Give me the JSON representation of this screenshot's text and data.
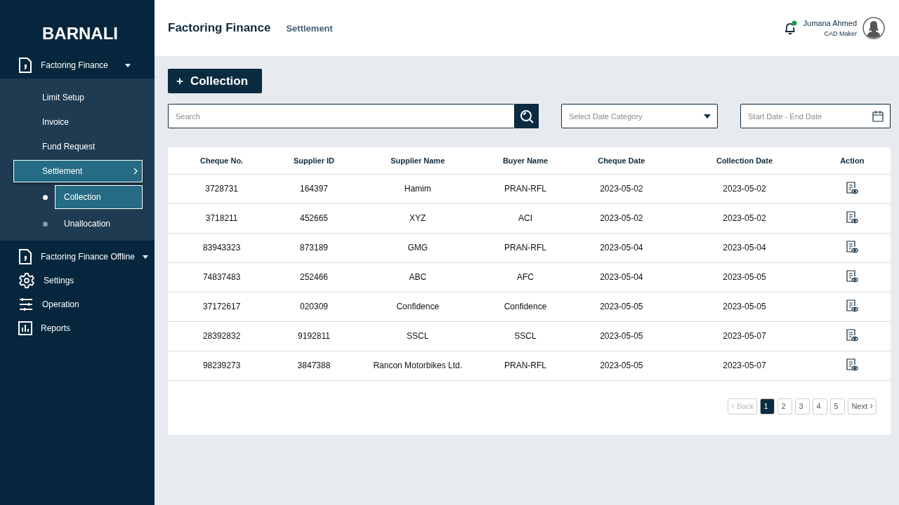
{
  "brand": "BARNALI",
  "sidebar": {
    "items": [
      {
        "kind": "menu",
        "label": "Factoring Finance",
        "children": [
          {
            "label": "Limit Setup",
            "selected": false
          },
          {
            "label": "Invoice",
            "selected": false
          },
          {
            "label": "Fund Request",
            "selected": false
          },
          {
            "label": "Settlement",
            "selected": true,
            "children": [
              {
                "label": "Collection",
                "selected": true
              },
              {
                "label": "Unallocation",
                "selected": false
              }
            ]
          }
        ]
      },
      {
        "kind": "menu",
        "label": "Factoring Finance Offline"
      },
      {
        "kind": "link",
        "label": "Settings"
      },
      {
        "kind": "link",
        "label": "Operation"
      },
      {
        "kind": "link",
        "label": "Reports"
      }
    ]
  },
  "header": {
    "title": "Factoring Finance",
    "breadcrumb": "Settlement",
    "notification_unread": true,
    "user": {
      "name": "Jumana Ahmed",
      "role": "CAD Maker"
    }
  },
  "add_button": {
    "icon": "+",
    "label": "Collection"
  },
  "filters": {
    "search": {
      "placeholder": "Search"
    },
    "date_category": {
      "placeholder": "Select Date Category"
    },
    "date_range": {
      "placeholder": "Start Date - End Date"
    }
  },
  "table": {
    "columns": [
      "Cheque No.",
      "Supplier ID",
      "Supplier Name",
      "Buyer Name",
      "Cheque Date",
      "Collection Date",
      "Action"
    ],
    "rows": [
      [
        "3728731",
        "164397",
        "Hamim",
        "PRAN-RFL",
        "2023-05-02",
        "2023-05-02"
      ],
      [
        "3718211",
        "452665",
        "XYZ",
        "ACI",
        "2023-05-02",
        "2023-05-02"
      ],
      [
        "83943323",
        "873189",
        "GMG",
        "PRAN-RFL",
        "2023-05-04",
        "2023-05-04"
      ],
      [
        "74837483",
        "252466",
        "ABC",
        "AFC",
        "2023-05-04",
        "2023-05-05"
      ],
      [
        "37172617",
        "020309",
        "Confidence",
        "Confidence",
        "2023-05-05",
        "2023-05-05"
      ],
      [
        "28392832",
        "9192811",
        "SSCL",
        "SSCL",
        "2023-05-05",
        "2023-05-07"
      ],
      [
        "98239273",
        "3847388",
        "Rancon Motorbikes Ltd.",
        "PRAN-RFL",
        "2023-05-05",
        "2023-05-07"
      ]
    ]
  },
  "pagination": {
    "back": {
      "label": "Back",
      "disabled": true
    },
    "pages": [
      {
        "label": "1",
        "selected": true
      },
      {
        "label": "2",
        "selected": false
      },
      {
        "label": "3",
        "selected": false
      },
      {
        "label": "4",
        "selected": false
      },
      {
        "label": "5",
        "selected": false
      }
    ],
    "next": {
      "label": "Next",
      "disabled": false
    }
  }
}
